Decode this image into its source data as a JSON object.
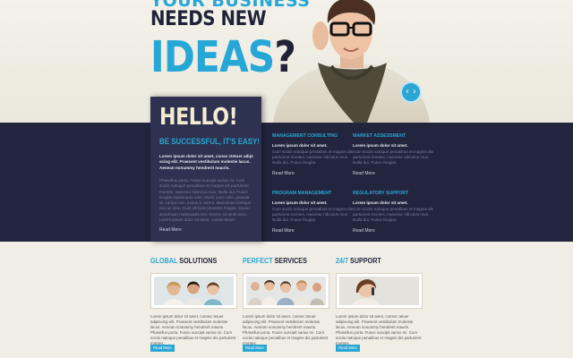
{
  "hero": {
    "line1": "YOUR BUSINESS",
    "line2": "NEEDS NEW",
    "line3_main": "IDEAS",
    "line3_q": "?",
    "slider_prev": "‹",
    "slider_next": "›"
  },
  "hello": {
    "title": "HELLO!",
    "subtitle": "BE SUCCESSFUL, IT'S EASY!",
    "bold": "Lorem ipsum dolor sit amet, conse ctetuer adipi scing elit. Praesent vestibulum molestie lacus. Aenean nonummy hendrerit mauris.",
    "text": "Phasellus porta. Fusce suscipit varius mi. Cum sociis natoque penatibus et magnis dis parturient montes, nascetur ridiculus mus. Nulla dui. Fusce feugiat malesuada odio. Morbi nunc odio, gravida at, cursus nec, luctus a, lorem. Maecenas tristique orci ac sem. Duis ultricies pharetra magna. Donec accumsan malesuada orci. Donec sit amet eros. Lorem ipsum dolor sit amet, consectetuer",
    "more": "Read More"
  },
  "services": [
    {
      "title": "MANAGEMENT CONSULTING",
      "bold": "Lorem ipsum dolor sit amet.",
      "text": "Cum sociis natoque penatibus et magnis dis parturient montes, nascetur ridiculus mus. Nulla dui. Fusce feugiat.",
      "more": "Read More"
    },
    {
      "title": "MARKET ASSESSMENT",
      "bold": "Lorem ipsum dolor sit amet.",
      "text": "Cum sociis natoque penatibus et magnis dis parturient montes, nascetur ridiculus mus. Nulla dui. Fusce feugiat.",
      "more": "Read More"
    },
    {
      "title": "PROGRAM MANAGEMENT",
      "bold": "Lorem ipsum dolor sit amet.",
      "text": "Cum sociis natoque penatibus et magnis dis parturient montes, nascetur ridiculus mus. Nulla dui. Fusce feugiat.",
      "more": "Read More"
    },
    {
      "title": "REGULATORY SUPPORT",
      "bold": "Lorem ipsum dolor sit amet.",
      "text": "Cum sociis natoque penatibus et magnis dis parturient montes, nascetur ridiculus mus. Nulla dui. Fusce feugiat.",
      "more": "Read More"
    }
  ],
  "features": [
    {
      "hl": "GLOBAL",
      "rest": " SOLUTIONS",
      "text": "Lorem ipsum dolor sit amet, consec tetuer adipiscing elit. Praesent vestibulum molestie lacus. Aenean nonummy hendrerit mauris. Phasellus porta. Fusce suscipit varius mi. Cum sociis natoque penatibus et magnis dis parturient montes.",
      "button": "Read More"
    },
    {
      "hl": "PERFECT",
      "rest": " SERVICES",
      "text": "Lorem ipsum dolor sit amet, consec tetuer adipiscing elit. Praesent vestibulum molestie lacus. Aenean nonummy hendrerit mauris. Phasellus porta. Fusce suscipit varius mi. Cum sociis natoque penatibus et magnis dis parturient montes.",
      "button": "Read More"
    },
    {
      "hl": "24/7",
      "rest": " SUPPORT",
      "text": "Lorem ipsum dolor sit amet, consec tetuer adipiscing elit. Praesent vestibulum molestie lacus. Aenean nonummy hendrerit mauris. Phasellus porta. Fusce suscipit varius mi. Cum sociis natoque penatibus et magnis dis parturient montes.",
      "button": "Read More"
    }
  ],
  "colors": {
    "accent": "#2aa6d4",
    "dark": "#23253e",
    "card": "#2e3150",
    "background": "#efede4"
  }
}
